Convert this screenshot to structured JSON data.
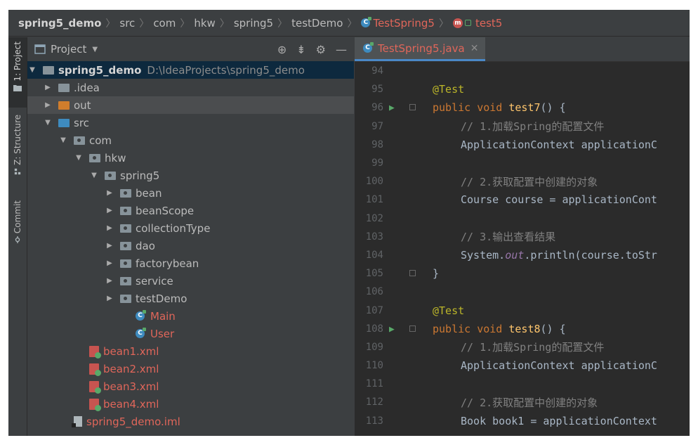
{
  "breadcrumb": {
    "items": [
      "spring5_demo",
      "src",
      "com",
      "hkw",
      "spring5",
      "testDemo",
      "TestSpring5",
      "test5"
    ]
  },
  "toolwindows": {
    "project": "1: Project",
    "structure": "Z: Structure",
    "commit": "Commit"
  },
  "project_panel": {
    "title": "Project",
    "tree": [
      {
        "label": "spring5_demo",
        "path": "D:\\IdeaProjects\\spring5_demo"
      },
      {
        "label": ".idea"
      },
      {
        "label": "out"
      },
      {
        "label": "src"
      },
      {
        "label": "com"
      },
      {
        "label": "hkw"
      },
      {
        "label": "spring5"
      },
      {
        "label": "bean"
      },
      {
        "label": "beanScope"
      },
      {
        "label": "collectionType"
      },
      {
        "label": "dao"
      },
      {
        "label": "factorybean"
      },
      {
        "label": "service"
      },
      {
        "label": "testDemo"
      },
      {
        "label": "Main"
      },
      {
        "label": "User"
      },
      {
        "label": "bean1.xml"
      },
      {
        "label": "bean2.xml"
      },
      {
        "label": "bean3.xml"
      },
      {
        "label": "bean4.xml"
      },
      {
        "label": "spring5_demo.iml"
      }
    ]
  },
  "editor": {
    "tab_label": "TestSpring5.java",
    "line_numbers": [
      "94",
      "95",
      "96",
      "97",
      "98",
      "99",
      "100",
      "101",
      "102",
      "103",
      "104",
      "105",
      "106",
      "107",
      "108",
      "109",
      "110",
      "111",
      "112",
      "113"
    ],
    "code": {
      "l95": "@Test",
      "l96_kw": "public void ",
      "l96_fn": "test7",
      "l96_rest": "() {",
      "l97": "// 1.加载Spring的配置文件",
      "l98": "ApplicationContext applicationC",
      "l100": "// 2.获取配置中创建的对象",
      "l101": "Course course = applicationCont",
      "l103": "// 3.输出查看结果",
      "l104_a": "System.",
      "l104_b": "out",
      "l104_c": ".println(course.toStr",
      "l105": "}",
      "l107": "@Test",
      "l108_kw": "public void ",
      "l108_fn": "test8",
      "l108_rest": "() {",
      "l109": "// 1.加载Spring的配置文件",
      "l110": "ApplicationContext applicationC",
      "l112": "// 2.获取配置中创建的对象",
      "l113": "Book book1 = applicationContext"
    }
  },
  "colors": {
    "accent": "#4a88c7",
    "error_file": "#e0665a",
    "keyword": "#cc7832",
    "annotation": "#bbb529",
    "method": "#ffc66d",
    "comment": "#808080"
  }
}
